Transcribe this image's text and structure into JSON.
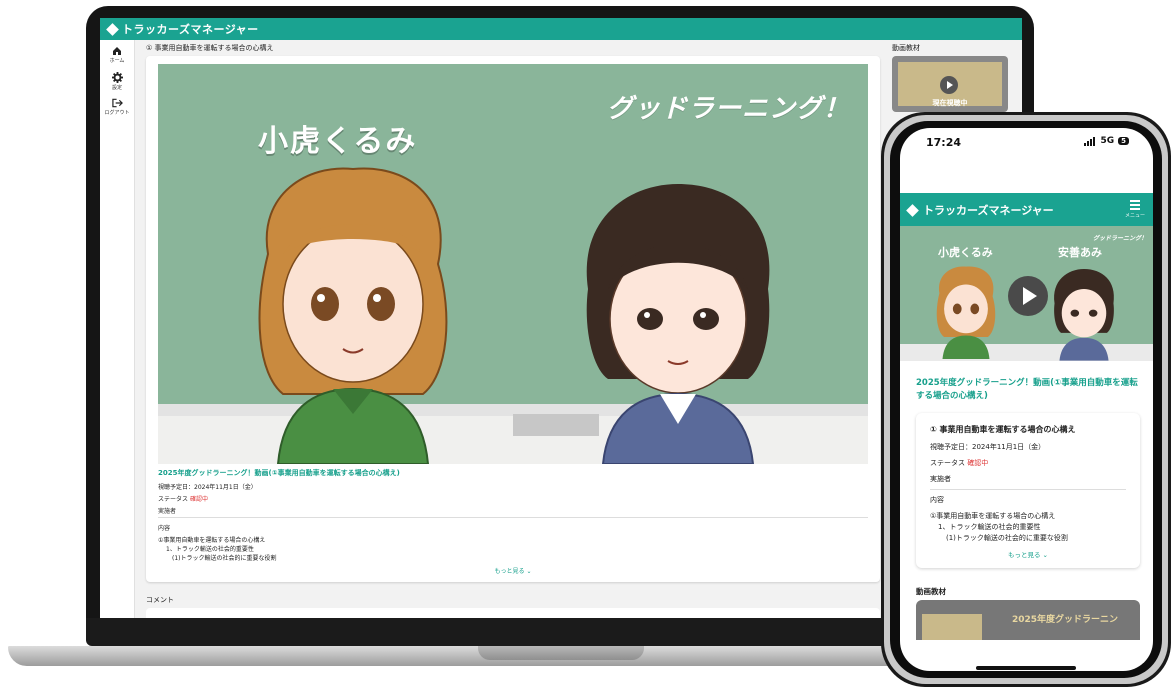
{
  "desktop": {
    "nav": [
      {
        "label": "ホーム",
        "icon": "home-icon"
      },
      {
        "label": "設定",
        "icon": "gear-icon"
      },
      {
        "label": "ログアウト",
        "icon": "logout-icon"
      }
    ],
    "page_title": "① 事業用自動車を運転する場合の心構え",
    "side_title": "動画教材",
    "thumb_label": "現在視聴中",
    "video": {
      "brand": "グッドラーニング！",
      "character_name": "小虎くるみ"
    },
    "lesson_title": "2025年度グッドラーニング！動画(①事業用自動車を運転する場合の心構え)",
    "schedule": "視聴予定日：2024年11月1日（金）",
    "status_label": "ステータス",
    "status_value": "確認中",
    "implementer_label": "実施者",
    "content_label": "内容",
    "content_lines": [
      "①事業用自動車を運転する場合の心構え",
      "1、トラック輸送の社会的重要性",
      "(1)トラック輸送の社会的に重要な役割"
    ],
    "more": "もっと見る ⌄",
    "comment_label": "コメント"
  },
  "mobile": {
    "time": "17:24",
    "network": "5G",
    "battery": "5",
    "menu_label": "メニュー",
    "video": {
      "brand": "グッドラーニング！",
      "name1": "小虎くるみ",
      "name2": "安善あみ"
    },
    "lesson_title": "2025年度グッドラーニング！動画(①事業用自動車を運転する場合の心構え)",
    "card_title": "① 事業用自動車を運転する場合の心構え",
    "schedule": "視聴予定日：2024年11月1日（金）",
    "status_label": "ステータス",
    "status_value": "確認中",
    "implementer_label": "実施者",
    "content_label": "内容",
    "content_lines": [
      "①事業用自動車を運転する場合の心構え",
      "1、トラック輸送の社会的重要性",
      "(1)トラック輸送の社会的に重要な役割"
    ],
    "more": "もっと見る ⌄",
    "section_title": "動画教材",
    "thumb_text": "2025年度グッドラーニン"
  },
  "brand": {
    "logo_text": "トラッカーズマネージャー",
    "accent": "#1aa391",
    "status_color": "#dd3333"
  }
}
